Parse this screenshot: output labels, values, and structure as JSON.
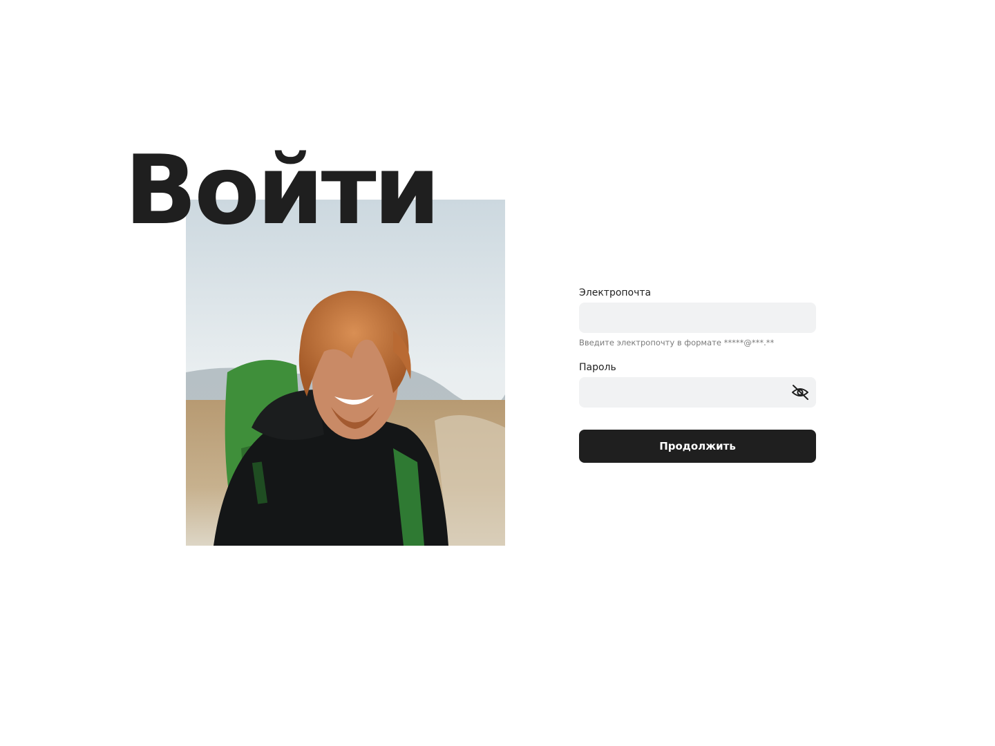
{
  "page": {
    "title": "Войти"
  },
  "photo": {
    "alt": "Smiling hiker with a green backpack in a field"
  },
  "form": {
    "email": {
      "label": "Электропочта",
      "value": "",
      "placeholder": "",
      "hint": "Введите электропочту в формате *****@***.**"
    },
    "password": {
      "label": "Пароль",
      "value": "",
      "placeholder": "",
      "toggle_icon": "eye-off-icon"
    },
    "submit_label": "Продолжить"
  },
  "colors": {
    "text": "#1f1f1f",
    "input_bg": "#f1f2f3",
    "hint": "#7a7a7a",
    "button_bg": "#1f1f1f",
    "button_text": "#ffffff"
  }
}
